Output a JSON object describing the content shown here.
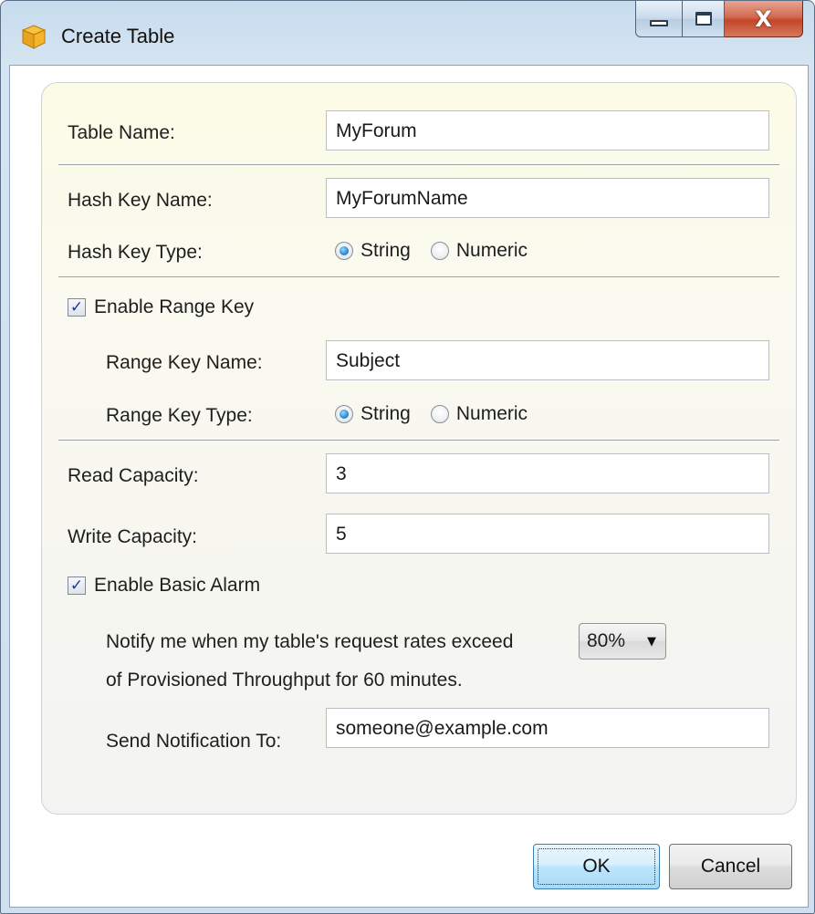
{
  "window": {
    "title": "Create Table",
    "close_glyph": "X",
    "icon": "package-icon"
  },
  "form": {
    "table_name_label": "Table Name:",
    "table_name_value": "MyForum",
    "hash_key_name_label": "Hash Key Name:",
    "hash_key_name_value": "MyForumName",
    "hash_key_type_label": "Hash Key Type:",
    "hash_key_type_options": [
      "String",
      "Numeric"
    ],
    "hash_key_type_selected": "String",
    "enable_range_key_label": "Enable Range Key",
    "enable_range_key_checked": true,
    "range_key_name_label": "Range Key Name:",
    "range_key_name_value": "Subject",
    "range_key_type_label": "Range Key Type:",
    "range_key_type_options": [
      "String",
      "Numeric"
    ],
    "range_key_type_selected": "String",
    "read_capacity_label": "Read Capacity:",
    "read_capacity_value": "3",
    "write_capacity_label": "Write Capacity:",
    "write_capacity_value": "5",
    "enable_alarm_label": "Enable Basic Alarm",
    "enable_alarm_checked": true,
    "notify_text_1": "Notify me when my table's request rates exceed",
    "threshold_value": "80%",
    "notify_text_2": "of Provisioned Throughput for 60 minutes.",
    "send_notification_label": "Send Notification To:",
    "send_notification_value": "someone@example.com"
  },
  "buttons": {
    "ok": "OK",
    "cancel": "Cancel"
  },
  "colors": {
    "radio_selected": "#2a8ad6",
    "ok_button": "#bee6fd",
    "panel_bg": "#fbfbe6"
  }
}
